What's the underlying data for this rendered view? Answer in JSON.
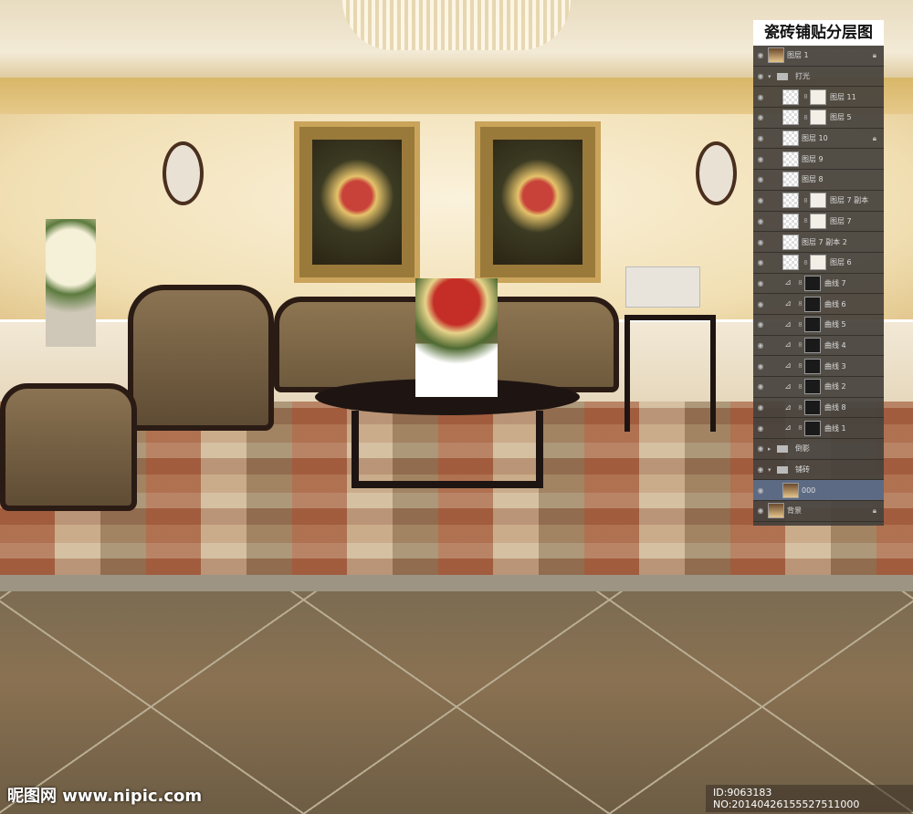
{
  "panel": {
    "title": "瓷砖铺贴分层图",
    "layers": [
      {
        "name": "图层 1",
        "type": "image",
        "locked": true
      },
      {
        "name": "打光",
        "type": "group",
        "expanded": true
      },
      {
        "name": "图层 11",
        "type": "masked"
      },
      {
        "name": "图层 5",
        "type": "masked"
      },
      {
        "name": "图层 10",
        "type": "plain",
        "locked": true
      },
      {
        "name": "图层 9",
        "type": "plain"
      },
      {
        "name": "图层 8",
        "type": "plain"
      },
      {
        "name": "图层 7 副本",
        "type": "masked"
      },
      {
        "name": "图层 7",
        "type": "masked"
      },
      {
        "name": "图层 7 副本 2",
        "type": "plain"
      },
      {
        "name": "图层 6",
        "type": "masked"
      },
      {
        "name": "曲线 7",
        "type": "curves"
      },
      {
        "name": "曲线 6",
        "type": "curves"
      },
      {
        "name": "曲线 5",
        "type": "curves"
      },
      {
        "name": "曲线 4",
        "type": "curves"
      },
      {
        "name": "曲线 3",
        "type": "curves"
      },
      {
        "name": "曲线 2",
        "type": "curves"
      },
      {
        "name": "曲线 8",
        "type": "curves"
      },
      {
        "name": "曲线 1",
        "type": "curves"
      },
      {
        "name": "倒影",
        "type": "group",
        "expanded": false
      },
      {
        "name": "铺砖",
        "type": "group",
        "expanded": true
      },
      {
        "name": "000",
        "type": "image",
        "selected": true
      },
      {
        "name": "背景",
        "type": "image",
        "locked": true
      }
    ]
  },
  "watermark": {
    "site": "昵图网 www.nipic.com",
    "id": "ID:9063183 NO:20140426155527511000"
  }
}
